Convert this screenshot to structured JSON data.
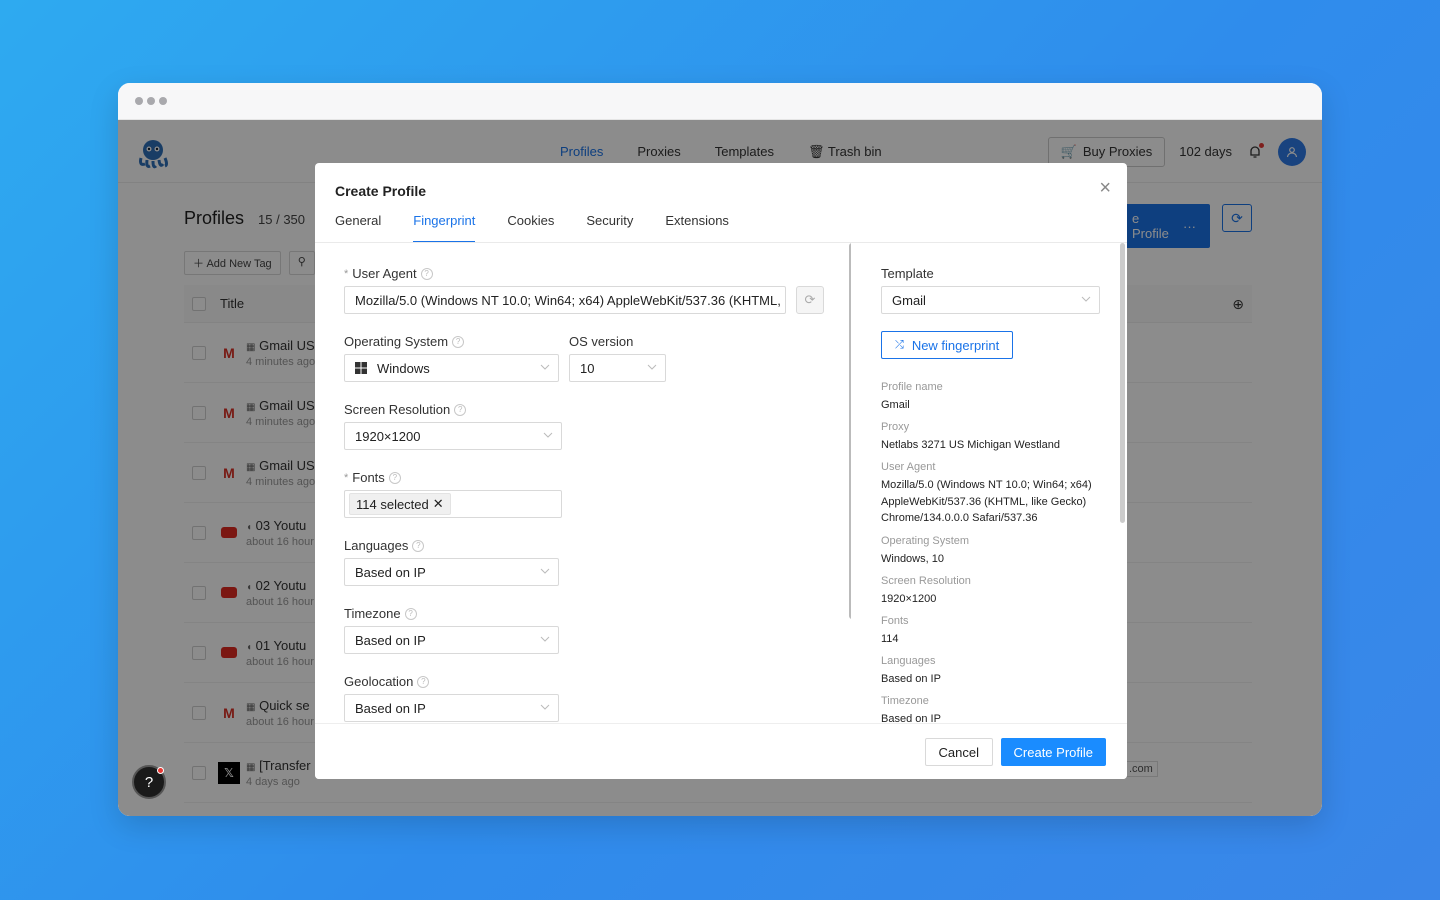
{
  "app": {
    "nav": [
      "Profiles",
      "Proxies",
      "Templates",
      "Trash bin"
    ],
    "buy_proxies": "Buy Proxies",
    "days_left": "102 days",
    "profiles_title": "Profiles",
    "profiles_count": "15 / 350",
    "new_profile_btn": "e Profile",
    "add_tag": "Add New Tag",
    "col_title": "Title",
    "rows": [
      {
        "title": "Gmail US",
        "time": "4 minutes ago",
        "icon": "gmail"
      },
      {
        "title": "Gmail US",
        "time": "4 minutes ago",
        "icon": "gmail"
      },
      {
        "title": "Gmail US",
        "time": "4 minutes ago",
        "icon": "gmail"
      },
      {
        "title": "03 Youtu",
        "time": "about 16 hour",
        "icon": "youtube"
      },
      {
        "title": "02 Youtu",
        "time": "about 16 hour",
        "icon": "youtube"
      },
      {
        "title": "01 Youtu",
        "time": "about 16 hour",
        "icon": "youtube"
      },
      {
        "title": "Quick se",
        "time": "about 16 hour",
        "icon": "gmail"
      },
      {
        "title": "[Transfer",
        "time": "4 days ago",
        "icon": "x"
      }
    ],
    "partial_com": ".com"
  },
  "modal": {
    "title": "Create Profile",
    "tabs": [
      "General",
      "Fingerprint",
      "Cookies",
      "Security",
      "Extensions"
    ],
    "active_tab": "Fingerprint",
    "user_agent_label": "User Agent",
    "user_agent_value": "Mozilla/5.0 (Windows NT 10.0; Win64; x64) AppleWebKit/537.36 (KHTML, like Gecko) Chrome/134.0.0.0 Safari/537.36",
    "os_label": "Operating System",
    "os_value": "Windows",
    "os_version_label": "OS version",
    "os_version_value": "10",
    "resolution_label": "Screen Resolution",
    "resolution_value": "1920×1200",
    "fonts_label": "Fonts",
    "fonts_value": "114 selected",
    "languages_label": "Languages",
    "languages_value": "Based on IP",
    "timezone_label": "Timezone",
    "timezone_value": "Based on IP",
    "geolocation_label": "Geolocation",
    "geolocation_value": "Based on IP",
    "template_label": "Template",
    "template_value": "Gmail",
    "new_fingerprint": "New fingerprint",
    "summary": [
      {
        "label": "Profile name",
        "value": "Gmail"
      },
      {
        "label": "Proxy",
        "value": "Netlabs 3271 US Michigan Westland"
      },
      {
        "label": "User Agent",
        "value": "Mozilla/5.0 (Windows NT 10.0; Win64; x64) AppleWebKit/537.36 (KHTML, like Gecko) Chrome/134.0.0.0 Safari/537.36"
      },
      {
        "label": "Operating System",
        "value": "Windows, 10"
      },
      {
        "label": "Screen Resolution",
        "value": "1920×1200"
      },
      {
        "label": "Fonts",
        "value": "114"
      },
      {
        "label": "Languages",
        "value": "Based on IP"
      },
      {
        "label": "Timezone",
        "value": "Based on IP"
      }
    ],
    "cancel": "Cancel",
    "create": "Create Profile"
  },
  "colors": {
    "accent": "#1a73e8",
    "primary_button": "#1a8cff",
    "gmail_red": "#d93025",
    "youtube_red": "#e02a21"
  }
}
